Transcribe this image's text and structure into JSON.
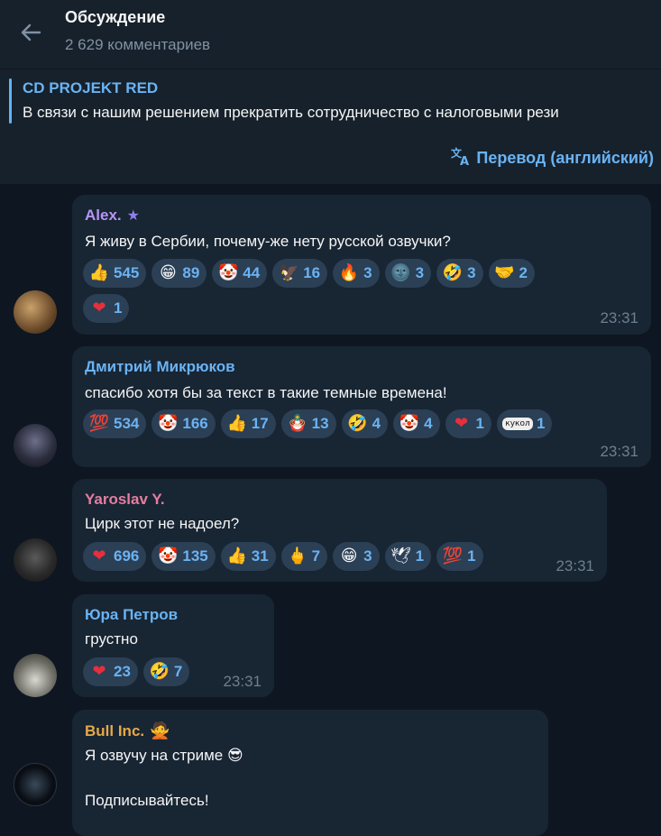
{
  "header": {
    "title": "Обсуждение",
    "subtitle": "2 629 комментариев"
  },
  "pinned": {
    "title": "CD PROJEKT RED",
    "text": "В связи с нашим решением прекратить сотрудничество с налоговыми рези"
  },
  "translate": {
    "label": "Перевод (английский)"
  },
  "messages": [
    {
      "name": "Alex.",
      "name_color": "#b794f6",
      "badge": "star-icon",
      "lines": [
        "Я живу в Сербии, почему-же нету русской озвучки?"
      ],
      "reactions": [
        {
          "emoji": "👍",
          "count": "545"
        },
        {
          "emoji": "😁",
          "count": "89"
        },
        {
          "emoji": "🤡",
          "count": "44"
        },
        {
          "emoji": "🦅",
          "count": "16"
        },
        {
          "emoji": "🔥",
          "count": "3"
        },
        {
          "emoji": "🌚",
          "count": "3"
        },
        {
          "emoji": "🤣",
          "count": "3"
        },
        {
          "emoji": "🤝",
          "count": "2"
        },
        {
          "emoji": "❤",
          "count": "1"
        }
      ],
      "time": "23:31"
    },
    {
      "name": "Дмитрий Микрюков",
      "name_color": "#6ab3f3",
      "lines": [
        "спасибо хотя бы за текст в такие темные времена!"
      ],
      "reactions": [
        {
          "emoji": "💯",
          "count": "534"
        },
        {
          "emoji": "🤡",
          "count": "166"
        },
        {
          "emoji": "👍",
          "count": "17"
        },
        {
          "emoji": "🪆",
          "count": "13"
        },
        {
          "emoji": "🤣",
          "count": "4"
        },
        {
          "emoji": "🤡",
          "count": "4"
        },
        {
          "emoji": "❤",
          "count": "1"
        },
        {
          "emoji": "кукол",
          "count": "1"
        }
      ],
      "time": "23:31"
    },
    {
      "name": "Yaroslav Y.",
      "name_color": "#e57ea0",
      "lines": [
        "Цирк этот не надоел?"
      ],
      "reactions": [
        {
          "emoji": "❤",
          "count": "696"
        },
        {
          "emoji": "🤡",
          "count": "135"
        },
        {
          "emoji": "👍",
          "count": "31"
        },
        {
          "emoji": "🖕",
          "count": "7"
        },
        {
          "emoji": "😁",
          "count": "3"
        },
        {
          "emoji": "🕊",
          "count": "1"
        },
        {
          "emoji": "💯",
          "count": "1"
        }
      ],
      "time": "23:31"
    },
    {
      "name": "Юра Петров",
      "name_color": "#6ab3f3",
      "lines": [
        "грустно"
      ],
      "reactions": [
        {
          "emoji": "❤",
          "count": "23"
        },
        {
          "emoji": "🤣",
          "count": "7"
        }
      ],
      "time": "23:31"
    },
    {
      "name": "Bull Inc.",
      "name_color": "#e6a948",
      "badge": "person-gesture-icon",
      "lines": [
        "Я озвучу на стриме 😎",
        "",
        "Подписывайтесь!"
      ]
    }
  ]
}
